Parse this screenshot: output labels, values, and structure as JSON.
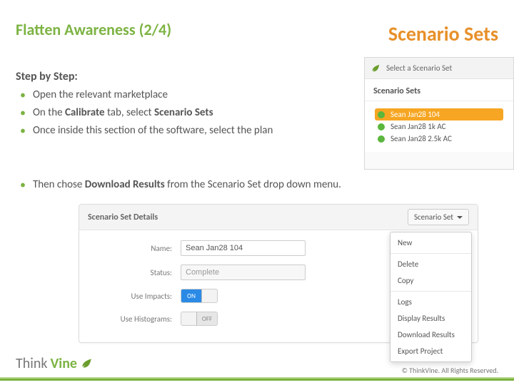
{
  "title": "Flatten Awareness (2/4)",
  "brand": "Scenario Sets",
  "steps_heading": "Step by Step:",
  "steps": [
    {
      "pre": "Open the relevant marketplace"
    },
    {
      "pre": "On the ",
      "b1": "Calibrate",
      "mid": " tab, select ",
      "b2": "Scenario Sets"
    },
    {
      "pre": "Once inside this section of the software, select the plan"
    }
  ],
  "step4": {
    "pre": "Then chose ",
    "b1": "Download Results",
    "post": " from the Scenario Set drop down menu."
  },
  "ss_panel": {
    "header": "Select a Scenario Set",
    "subtitle": "Scenario Sets",
    "items": [
      {
        "label": "Sean Jan28 104",
        "selected": true
      },
      {
        "label": "Sean Jan28 1k AC",
        "selected": false
      },
      {
        "label": "Sean Jan28 2.5k AC",
        "selected": false
      }
    ]
  },
  "details": {
    "title": "Scenario Set Details",
    "dropdown_label": "Scenario Set",
    "fields": {
      "name_label": "Name:",
      "name_value": "Sean Jan28 104",
      "status_label": "Status:",
      "status_value": "Complete",
      "impacts_label": "Use Impacts:",
      "impacts_on": "ON",
      "histograms_label": "Use Histograms:",
      "histograms_off": "OFF"
    },
    "menu": {
      "new": "New",
      "delete": "Delete",
      "copy": "Copy",
      "logs": "Logs",
      "display": "Display Results",
      "download": "Download Results",
      "export": "Export Project"
    }
  },
  "footer": {
    "think": "Think",
    "vine": "Vine",
    "copyright": "© ThinkVine.  All Rights Reserved."
  }
}
